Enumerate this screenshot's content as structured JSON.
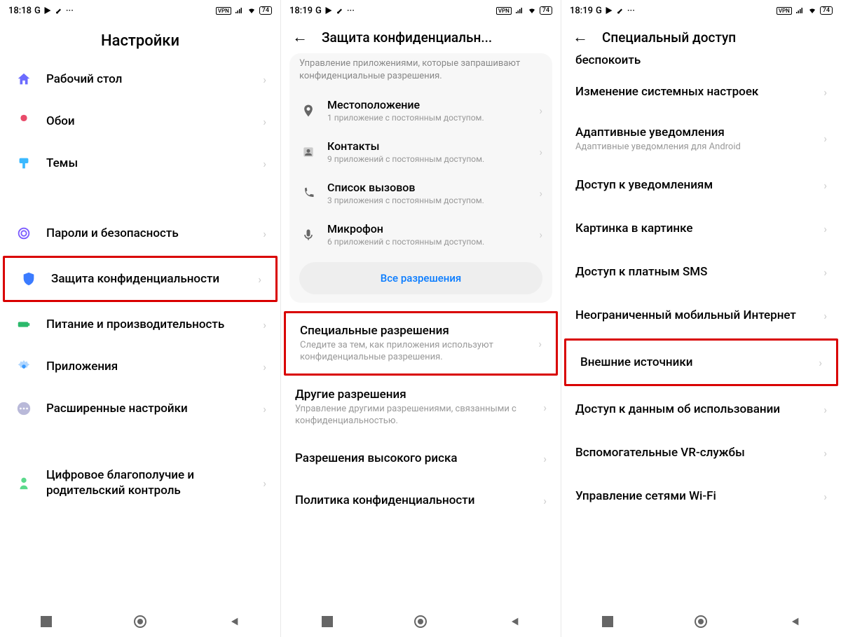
{
  "screens": {
    "a": {
      "status": {
        "time": "18:18",
        "battery": "74"
      },
      "title": "Настройки",
      "items": [
        {
          "title": "Рабочий стол"
        },
        {
          "title": "Обои"
        },
        {
          "title": "Темы"
        },
        {
          "title": "Пароли и безопасность"
        },
        {
          "title": "Защита конфиденциальности"
        },
        {
          "title": "Питание и производительность"
        },
        {
          "title": "Приложения"
        },
        {
          "title": "Расширенные настройки"
        },
        {
          "title": "Цифровое благополучие и родительский контроль"
        }
      ]
    },
    "b": {
      "status": {
        "time": "18:19",
        "battery": "74"
      },
      "title": "Защита конфиденциальн...",
      "card_desc": "Управление приложениями, которые запрашивают конфиденциальные разрешения.",
      "perms": [
        {
          "title": "Местоположение",
          "sub": "1 приложение с постоянным доступом."
        },
        {
          "title": "Контакты",
          "sub": "9 приложений с постоянным доступом."
        },
        {
          "title": "Список вызовов",
          "sub": "3 приложения с постоянным доступом."
        },
        {
          "title": "Микрофон",
          "sub": "6 приложений с постоянным доступом."
        }
      ],
      "all_perm": "Все разрешения",
      "special": {
        "title": "Специальные разрешения",
        "sub": "Следите за тем, как приложения используют конфиденциальные разрешения."
      },
      "other": {
        "title": "Другие разрешения",
        "sub": "Управление другими разрешениями, связанными с конфиденциальностью."
      },
      "highrisk": "Разрешения высокого риска",
      "policy": "Политика конфиденциальности"
    },
    "c": {
      "status": {
        "time": "18:19",
        "battery": "74"
      },
      "title": "Специальный доступ",
      "cut_top": "беспокоить",
      "items": [
        {
          "title": "Изменение системных настроек"
        },
        {
          "title": "Адаптивные уведомления",
          "sub": "Адаптивные уведомления для Android"
        },
        {
          "title": "Доступ к уведомлениям"
        },
        {
          "title": "Картинка в картинке"
        },
        {
          "title": "Доступ к платным SMS"
        },
        {
          "title": "Неограниченный мобильный Интернет"
        },
        {
          "title": "Внешние источники"
        },
        {
          "title": "Доступ к данным об использовании"
        },
        {
          "title": "Вспомогательные VR-службы"
        },
        {
          "title": "Управление сетями Wi-Fi"
        }
      ]
    }
  }
}
